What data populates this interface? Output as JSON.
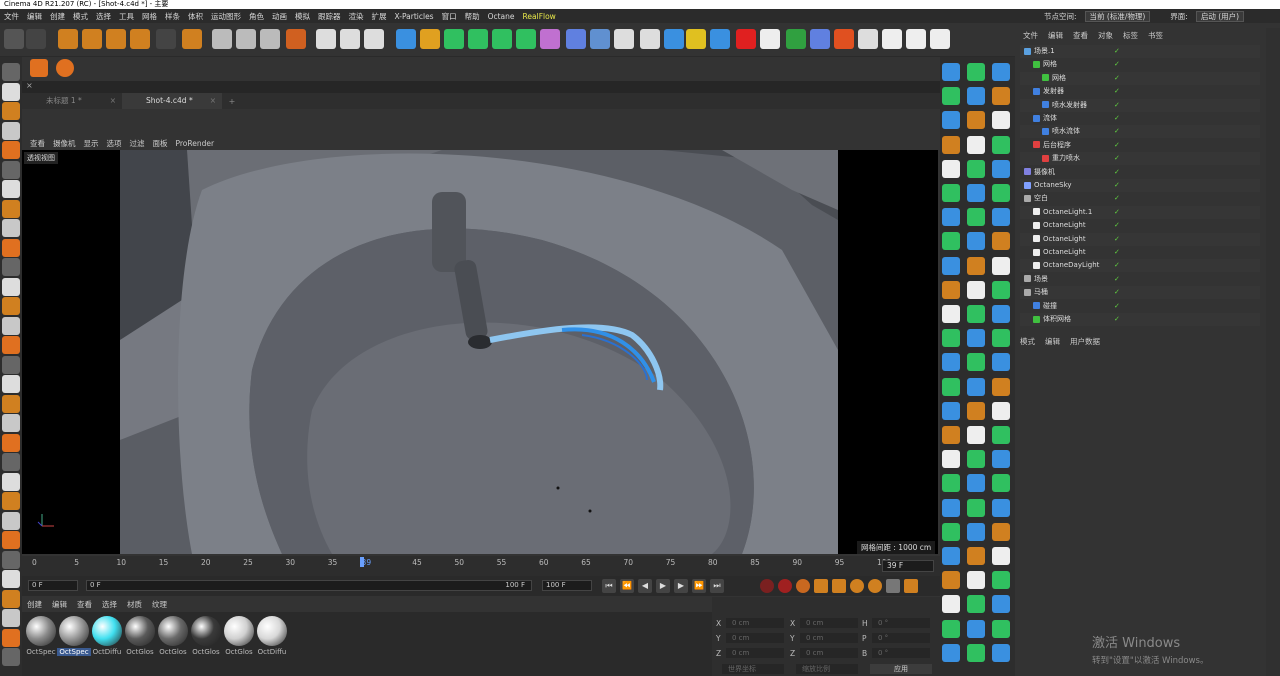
{
  "titlebar": {
    "title": "Cinema 4D R21.207 (RC) - [Shot-4.c4d *] - 主要"
  },
  "menu": {
    "items": [
      "文件",
      "编辑",
      "创建",
      "模式",
      "选择",
      "工具",
      "网格",
      "样条",
      "体积",
      "运动图形",
      "角色",
      "动画",
      "模拟",
      "跟踪器",
      "渲染",
      "扩展",
      "X-Particles",
      "窗口",
      "帮助",
      "Octane",
      "RealFlow"
    ],
    "node_space_label": "节点空间:",
    "node_space_value": "当前 (标准/物理)",
    "layout_label": "界面:",
    "layout_value": "启动 (用户)"
  },
  "tabs": [
    {
      "label": "未标题 1 *",
      "active": false
    },
    {
      "label": "Shot-4.c4d *",
      "active": true
    }
  ],
  "viewport": {
    "menu": [
      "查看",
      "摄像机",
      "显示",
      "选项",
      "过滤",
      "面板",
      "ProRender"
    ],
    "label": "透视视图",
    "grid_spacing": "网格间距 : 1000 cm"
  },
  "timeline": {
    "ticks": [
      "0",
      "5",
      "10",
      "15",
      "20",
      "25",
      "30",
      "35",
      "39",
      "45",
      "50",
      "55",
      "60",
      "65",
      "70",
      "75",
      "80",
      "85",
      "90",
      "95",
      "100"
    ],
    "current_frame": "39 F",
    "start": "0 F",
    "range_start": "0 F",
    "range_end": "100 F",
    "end": "100 F"
  },
  "materials": {
    "menu": [
      "创建",
      "编辑",
      "查看",
      "选择",
      "材质",
      "纹理"
    ],
    "items": [
      {
        "label": "OctSpec",
        "color": "#8a8a8a"
      },
      {
        "label": "OctSpec",
        "color": "#9a9a9a"
      },
      {
        "label": "OctDiffu",
        "color": "#40e0f0"
      },
      {
        "label": "OctGlos",
        "color": "#5a5a5a"
      },
      {
        "label": "OctGlos",
        "color": "#6a6a6a"
      },
      {
        "label": "OctGlos",
        "color": "#3a3a3a"
      },
      {
        "label": "OctGlos",
        "color": "#d0d0d0"
      },
      {
        "label": "OctDiffu",
        "color": "#d8d8d8"
      }
    ]
  },
  "coords": {
    "labels": [
      "X",
      "Y",
      "Z",
      "X",
      "Y",
      "Z",
      "H",
      "P",
      "B"
    ],
    "values": [
      "0 cm",
      "0 cm",
      "0 cm",
      "0 cm",
      "0 cm",
      "0 cm",
      "0 °",
      "0 °",
      "0 °"
    ],
    "world": "世界坐标",
    "scale": "缩放比例",
    "apply": "应用"
  },
  "objects": {
    "menu": [
      "文件",
      "编辑",
      "查看",
      "对象",
      "标签",
      "书签"
    ],
    "rows": [
      {
        "name": "场景.1",
        "indent": 0,
        "color": "#5aa0e0"
      },
      {
        "name": "网格",
        "indent": 1,
        "color": "#40c040"
      },
      {
        "name": "网格",
        "indent": 2,
        "color": "#40c040"
      },
      {
        "name": "发射器",
        "indent": 1,
        "color": "#4080e0"
      },
      {
        "name": "喷水发射器",
        "indent": 2,
        "color": "#4080e0"
      },
      {
        "name": "流体",
        "indent": 1,
        "color": "#4080e0"
      },
      {
        "name": "喷水流体",
        "indent": 2,
        "color": "#4080e0"
      },
      {
        "name": "后台程序",
        "indent": 1,
        "color": "#e04040"
      },
      {
        "name": "重力喷水",
        "indent": 2,
        "color": "#e04040"
      },
      {
        "name": "摄像机",
        "indent": 0,
        "color": "#8080e0"
      },
      {
        "name": "OctaneSky",
        "indent": 0,
        "color": "#80a0ff"
      },
      {
        "name": "空白",
        "indent": 0,
        "color": "#aaaaaa"
      },
      {
        "name": "OctaneLight.1",
        "indent": 1,
        "color": "#eeeeee"
      },
      {
        "name": "OctaneLight",
        "indent": 1,
        "color": "#eeeeee"
      },
      {
        "name": "OctaneLight",
        "indent": 1,
        "color": "#eeeeee"
      },
      {
        "name": "OctaneLight",
        "indent": 1,
        "color": "#eeeeee"
      },
      {
        "name": "OctaneDayLight",
        "indent": 1,
        "color": "#eeeeee"
      },
      {
        "name": "场景",
        "indent": 0,
        "color": "#aaaaaa"
      },
      {
        "name": "马桶",
        "indent": 0,
        "color": "#aaaaaa"
      },
      {
        "name": "碰撞",
        "indent": 1,
        "color": "#4080e0"
      },
      {
        "name": "体积网格",
        "indent": 1,
        "color": "#40c040"
      }
    ]
  },
  "attributes": {
    "menu": [
      "模式",
      "编辑",
      "用户数据"
    ]
  },
  "windows_activation": {
    "line1": "激活 Windows",
    "line2": "转到\"设置\"以激活 Windows。"
  }
}
